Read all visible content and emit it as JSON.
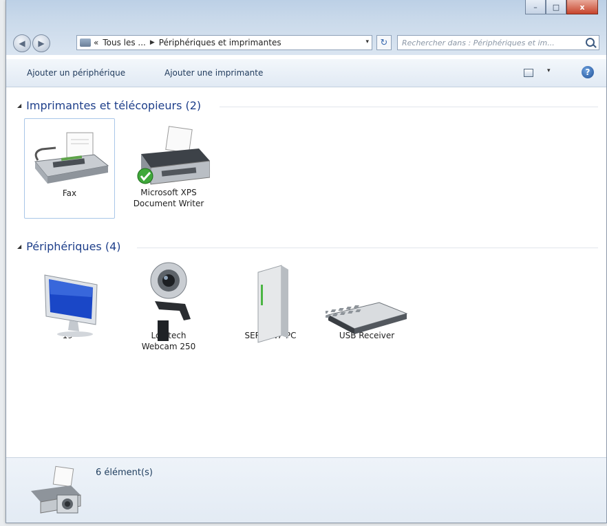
{
  "window": {
    "controls": {
      "minimize": "–",
      "maximize": "□",
      "close": "x"
    }
  },
  "nav": {
    "back_glyph": "◀",
    "forward_glyph": "▶",
    "breadcrumb": {
      "overflow": "«",
      "segment1": "Tous les ...",
      "separator": "▶",
      "segment2": "Périphériques et imprimantes"
    },
    "dropdown_glyph": "▾",
    "refresh_glyph": "↻",
    "search_placeholder": "Rechercher dans : Périphériques et im..."
  },
  "toolbar": {
    "add_device": "Ajouter un périphérique",
    "add_printer": "Ajouter une imprimante",
    "view_dropdown_glyph": "▾",
    "help_glyph": "?"
  },
  "groups": [
    {
      "title": "Imprimantes et télécopieurs (2)",
      "items": [
        {
          "label": "Fax",
          "icon": "fax-icon",
          "selected": true
        },
        {
          "label": "Microsoft XPS\nDocument Writer",
          "icon": "printer-icon",
          "default": true
        }
      ]
    },
    {
      "title": "Périphériques (4)",
      "items": [
        {
          "label": "19\"",
          "icon": "monitor-icon"
        },
        {
          "label": "Logitech\nWebcam 250",
          "icon": "webcam-icon"
        },
        {
          "label": "SERWIN7-PC",
          "icon": "computer-icon"
        },
        {
          "label": "USB Receiver",
          "icon": "keyboard-icon"
        }
      ]
    }
  ],
  "status": {
    "count_text": "6 élément(s)"
  },
  "colors": {
    "link": "#1e395b",
    "group_heading": "#1e3f8a",
    "accent": "#3a6ab0"
  }
}
